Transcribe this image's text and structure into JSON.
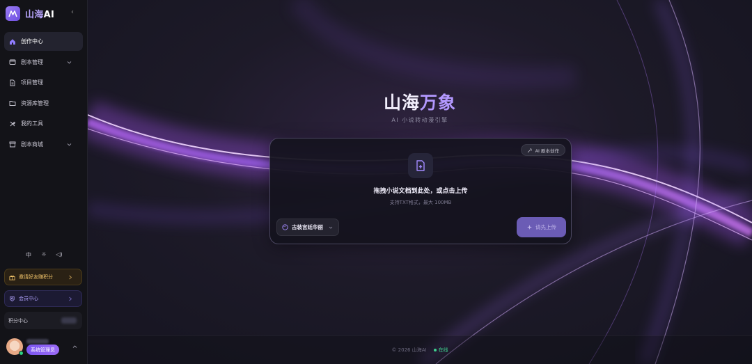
{
  "brand": {
    "name_prefix": "山海",
    "name_suffix": "AI"
  },
  "sidebar": {
    "items": [
      {
        "label": "创作中心",
        "icon": "home-icon",
        "active": true
      },
      {
        "label": "剧本管理",
        "icon": "film-icon",
        "has_submenu": true
      },
      {
        "label": "项目管理",
        "icon": "document-icon"
      },
      {
        "label": "资源库管理",
        "icon": "folder-icon"
      },
      {
        "label": "我的工具",
        "icon": "tools-icon"
      },
      {
        "label": "剧本商城",
        "icon": "store-icon",
        "has_submenu": true
      }
    ],
    "tools": {
      "language": "中",
      "theme_icon": "sun-icon",
      "sound_icon": "speaker-icon"
    },
    "invite_label": "邀请好友赚积分",
    "member_label": "会员中心",
    "points_label": "积分中心",
    "user": {
      "role": "系统管理员"
    }
  },
  "main": {
    "title_white": "山海",
    "title_purple": "万象",
    "subtitle": "AI 小说转动漫引擎",
    "upload": {
      "ai_script_button": "AI 剧本创作",
      "drop_title": "拖拽小说文档到此处，或点击上传",
      "drop_hint": "支持TXT格式，最大 100MB",
      "style_select": "古装宫廷华丽",
      "upload_button": "请先上传"
    },
    "footer": {
      "copyright": "© 2026 山海AI",
      "status": "在线"
    }
  },
  "colors": {
    "accent": "#9b7cf6",
    "online": "#3ed28f",
    "invite": "#f0c36a"
  }
}
